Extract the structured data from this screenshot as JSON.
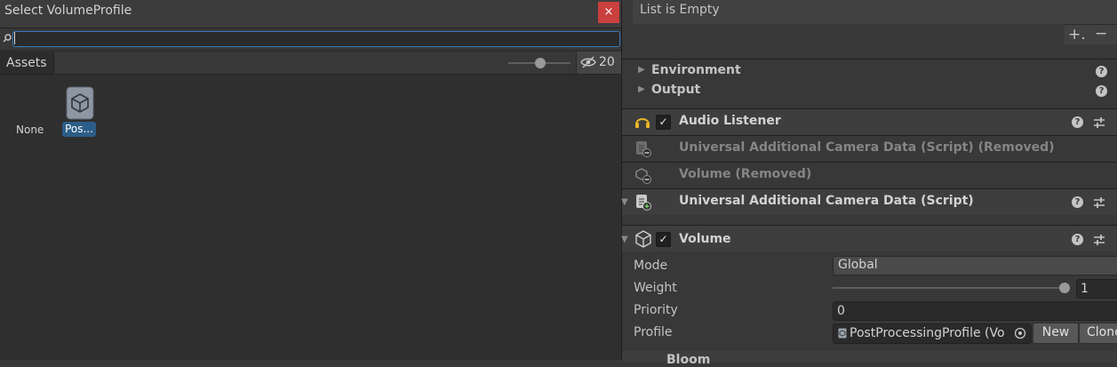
{
  "picker": {
    "title": "Select VolumeProfile",
    "close_label": "×",
    "search": {
      "value": "",
      "placeholder": ""
    },
    "tab_label": "Assets",
    "zoom_level": 0.25,
    "hidden_count": "20",
    "assets": [
      {
        "label": "None",
        "selected": false
      },
      {
        "label": "Pos...",
        "selected": true,
        "icon": "volume-profile-icon"
      }
    ]
  },
  "inspector": {
    "list_empty_label": "List is Empty",
    "add_label": "+.",
    "remove_label": "−",
    "foldouts": [
      {
        "label": "Environment",
        "icon": "help-icon"
      },
      {
        "label": "Output",
        "icon": "help-icon"
      }
    ],
    "help_glyph": "?",
    "check_glyph": "✓",
    "components": {
      "audio_listener": "Audio Listener",
      "camera_data_removed": "Universal Additional Camera Data (Script) (Removed)",
      "volume_removed": "Volume (Removed)",
      "camera_data": "Universal Additional Camera Data (Script)",
      "volume": "Volume"
    },
    "volume_props": {
      "mode_label": "Mode",
      "mode_value": "Global",
      "weight_label": "Weight",
      "weight_value": "1",
      "weight_slider_fraction": 1,
      "priority_label": "Priority",
      "priority_value": "0",
      "profile_label": "Profile",
      "profile_value": "PostProcessingProfile (Vo",
      "new_label": "New",
      "clone_label": "Clone"
    },
    "next_component": "Bloom"
  },
  "colors": {
    "accent_blue": "#3a79bb",
    "selection_blue": "#2c5d87",
    "close_red": "#c9403f",
    "listener_yellow": "#e8b52a"
  }
}
